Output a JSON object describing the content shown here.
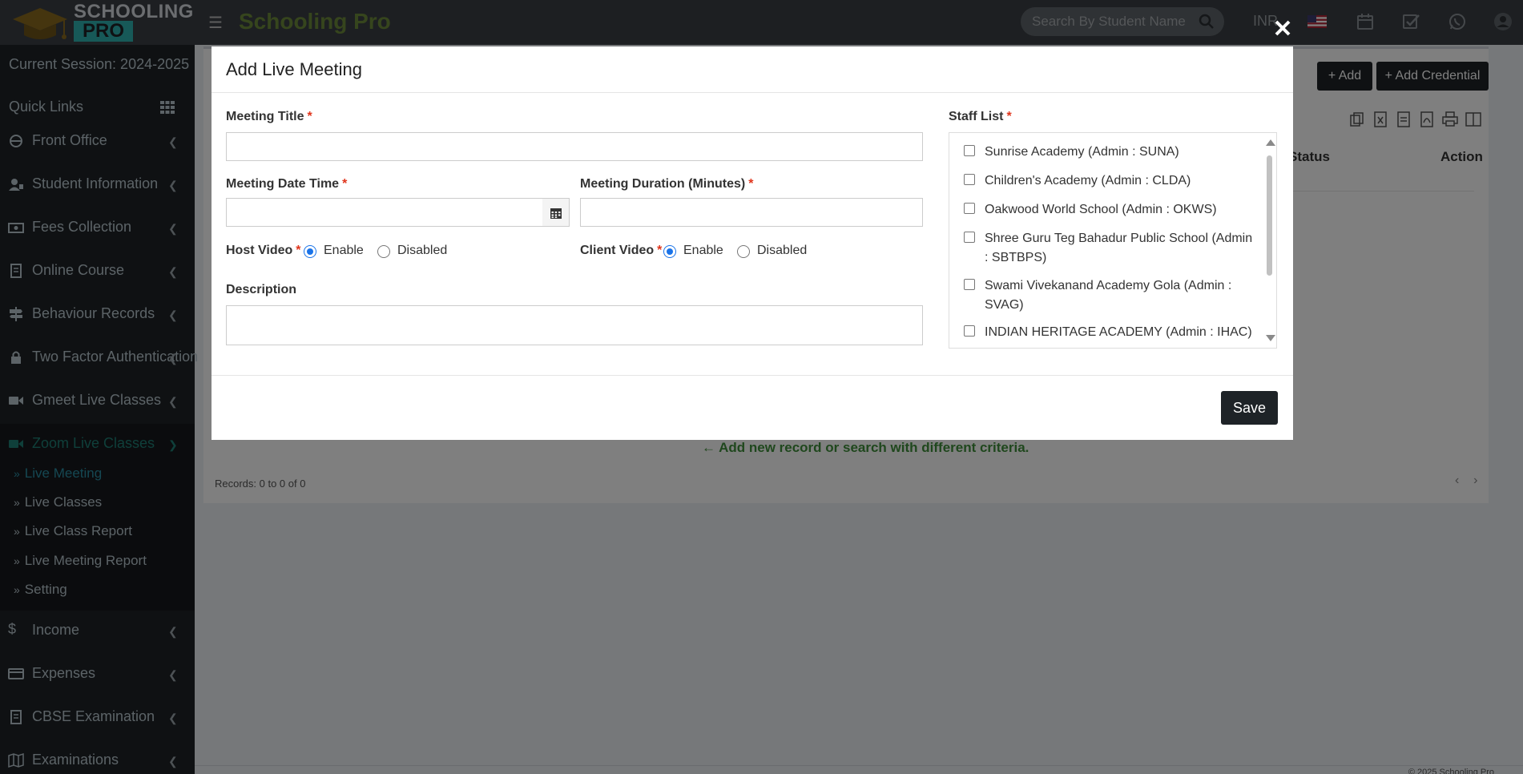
{
  "topbar": {
    "logo_line1": "SCHOOLING",
    "logo_line2": "PRO",
    "brand": "Schooling Pro",
    "search_placeholder": "Search By Student Name",
    "currency": "INR",
    "icons": [
      "hamburger-icon",
      "search-icon",
      "us-flag-icon",
      "calendar-icon",
      "task-check-icon",
      "whatsapp-icon",
      "user-avatar-icon"
    ]
  },
  "sidebar": {
    "session": "Current Session: 2024-2025",
    "quick_links": "Quick Links",
    "items": [
      {
        "label": "Front Office",
        "icon": "front-office-icon"
      },
      {
        "label": "Student Information",
        "icon": "student-icon"
      },
      {
        "label": "Fees Collection",
        "icon": "money-icon"
      },
      {
        "label": "Online Course",
        "icon": "course-icon"
      },
      {
        "label": "Behaviour Records",
        "icon": "signpost-icon"
      },
      {
        "label": "Two Factor Authentication",
        "icon": "lock-icon"
      },
      {
        "label": "Gmeet Live Classes",
        "icon": "video-icon"
      },
      {
        "label": "Zoom Live Classes",
        "icon": "video-icon"
      }
    ],
    "sub_items": [
      {
        "label": "Live Meeting"
      },
      {
        "label": "Live Classes"
      },
      {
        "label": "Live Class Report"
      },
      {
        "label": "Live Meeting Report"
      },
      {
        "label": "Setting"
      }
    ],
    "items_after": [
      {
        "label": "Income",
        "icon": "dollar-icon"
      },
      {
        "label": "Expenses",
        "icon": "card-icon"
      },
      {
        "label": "CBSE Examination",
        "icon": "exam-icon"
      },
      {
        "label": "Examinations",
        "icon": "map-icon"
      }
    ]
  },
  "content": {
    "add_label": "Add",
    "add_credential_label": "Add Credential",
    "status_header": "Status",
    "action_header": "Action",
    "empty_message": "Add new record or search with different criteria.",
    "records": "Records: 0 to 0 of 0",
    "footer": "© 2025 Schooling Pro"
  },
  "modal": {
    "title": "Add Live Meeting",
    "meeting_title_label": "Meeting Title",
    "meeting_title_value": "",
    "date_time_label": "Meeting Date Time",
    "date_time_value": "",
    "duration_label": "Meeting Duration (Minutes)",
    "duration_value": "",
    "host_video_label": "Host Video",
    "client_video_label": "Client Video",
    "enable_label": "Enable",
    "disabled_label": "Disabled",
    "host_video_selected": "Enable",
    "client_video_selected": "Enable",
    "description_label": "Description",
    "description_value": "",
    "staff_list_label": "Staff List",
    "staff_list": [
      {
        "label": "Sunrise Academy (Admin : SUNA)",
        "checked": false
      },
      {
        "label": "Children's Academy (Admin : CLDA)",
        "checked": false
      },
      {
        "label": "Oakwood World School (Admin : OKWS)",
        "checked": false
      },
      {
        "label": "Shree Guru Teg Bahadur Public School (Admin : SBTBPS)",
        "checked": false
      },
      {
        "label": "Swami Vivekanand Academy Gola (Admin : SVAG)",
        "checked": false
      },
      {
        "label": "INDIAN HERITAGE ACADEMY (Admin : IHAC)",
        "checked": false
      }
    ],
    "save_label": "Save"
  },
  "colors": {
    "topbar": "#3a3f44",
    "sidebar": "#1f2327",
    "brand": "#6d8a3a",
    "accent": "#1f7f75",
    "required": "#e0341b",
    "button_dark": "#1e2327"
  }
}
